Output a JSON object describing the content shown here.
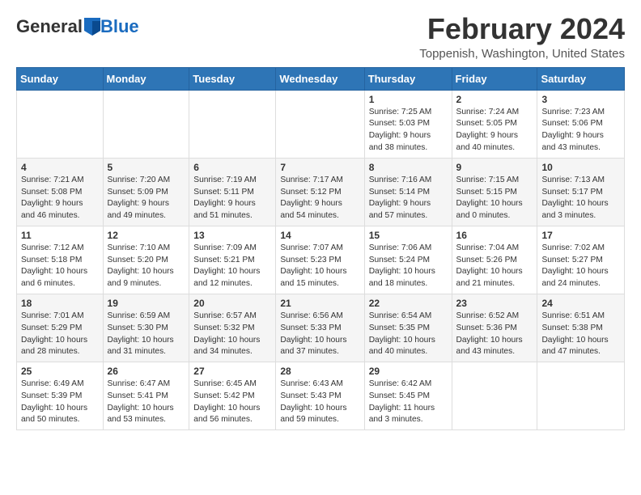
{
  "header": {
    "logo": {
      "part1": "General",
      "part2": "Blue"
    },
    "title": "February 2024",
    "location": "Toppenish, Washington, United States"
  },
  "days_of_week": [
    "Sunday",
    "Monday",
    "Tuesday",
    "Wednesday",
    "Thursday",
    "Friday",
    "Saturday"
  ],
  "weeks": [
    [
      {
        "day": "",
        "info": ""
      },
      {
        "day": "",
        "info": ""
      },
      {
        "day": "",
        "info": ""
      },
      {
        "day": "",
        "info": ""
      },
      {
        "day": "1",
        "info": "Sunrise: 7:25 AM\nSunset: 5:03 PM\nDaylight: 9 hours\nand 38 minutes."
      },
      {
        "day": "2",
        "info": "Sunrise: 7:24 AM\nSunset: 5:05 PM\nDaylight: 9 hours\nand 40 minutes."
      },
      {
        "day": "3",
        "info": "Sunrise: 7:23 AM\nSunset: 5:06 PM\nDaylight: 9 hours\nand 43 minutes."
      }
    ],
    [
      {
        "day": "4",
        "info": "Sunrise: 7:21 AM\nSunset: 5:08 PM\nDaylight: 9 hours\nand 46 minutes."
      },
      {
        "day": "5",
        "info": "Sunrise: 7:20 AM\nSunset: 5:09 PM\nDaylight: 9 hours\nand 49 minutes."
      },
      {
        "day": "6",
        "info": "Sunrise: 7:19 AM\nSunset: 5:11 PM\nDaylight: 9 hours\nand 51 minutes."
      },
      {
        "day": "7",
        "info": "Sunrise: 7:17 AM\nSunset: 5:12 PM\nDaylight: 9 hours\nand 54 minutes."
      },
      {
        "day": "8",
        "info": "Sunrise: 7:16 AM\nSunset: 5:14 PM\nDaylight: 9 hours\nand 57 minutes."
      },
      {
        "day": "9",
        "info": "Sunrise: 7:15 AM\nSunset: 5:15 PM\nDaylight: 10 hours\nand 0 minutes."
      },
      {
        "day": "10",
        "info": "Sunrise: 7:13 AM\nSunset: 5:17 PM\nDaylight: 10 hours\nand 3 minutes."
      }
    ],
    [
      {
        "day": "11",
        "info": "Sunrise: 7:12 AM\nSunset: 5:18 PM\nDaylight: 10 hours\nand 6 minutes."
      },
      {
        "day": "12",
        "info": "Sunrise: 7:10 AM\nSunset: 5:20 PM\nDaylight: 10 hours\nand 9 minutes."
      },
      {
        "day": "13",
        "info": "Sunrise: 7:09 AM\nSunset: 5:21 PM\nDaylight: 10 hours\nand 12 minutes."
      },
      {
        "day": "14",
        "info": "Sunrise: 7:07 AM\nSunset: 5:23 PM\nDaylight: 10 hours\nand 15 minutes."
      },
      {
        "day": "15",
        "info": "Sunrise: 7:06 AM\nSunset: 5:24 PM\nDaylight: 10 hours\nand 18 minutes."
      },
      {
        "day": "16",
        "info": "Sunrise: 7:04 AM\nSunset: 5:26 PM\nDaylight: 10 hours\nand 21 minutes."
      },
      {
        "day": "17",
        "info": "Sunrise: 7:02 AM\nSunset: 5:27 PM\nDaylight: 10 hours\nand 24 minutes."
      }
    ],
    [
      {
        "day": "18",
        "info": "Sunrise: 7:01 AM\nSunset: 5:29 PM\nDaylight: 10 hours\nand 28 minutes."
      },
      {
        "day": "19",
        "info": "Sunrise: 6:59 AM\nSunset: 5:30 PM\nDaylight: 10 hours\nand 31 minutes."
      },
      {
        "day": "20",
        "info": "Sunrise: 6:57 AM\nSunset: 5:32 PM\nDaylight: 10 hours\nand 34 minutes."
      },
      {
        "day": "21",
        "info": "Sunrise: 6:56 AM\nSunset: 5:33 PM\nDaylight: 10 hours\nand 37 minutes."
      },
      {
        "day": "22",
        "info": "Sunrise: 6:54 AM\nSunset: 5:35 PM\nDaylight: 10 hours\nand 40 minutes."
      },
      {
        "day": "23",
        "info": "Sunrise: 6:52 AM\nSunset: 5:36 PM\nDaylight: 10 hours\nand 43 minutes."
      },
      {
        "day": "24",
        "info": "Sunrise: 6:51 AM\nSunset: 5:38 PM\nDaylight: 10 hours\nand 47 minutes."
      }
    ],
    [
      {
        "day": "25",
        "info": "Sunrise: 6:49 AM\nSunset: 5:39 PM\nDaylight: 10 hours\nand 50 minutes."
      },
      {
        "day": "26",
        "info": "Sunrise: 6:47 AM\nSunset: 5:41 PM\nDaylight: 10 hours\nand 53 minutes."
      },
      {
        "day": "27",
        "info": "Sunrise: 6:45 AM\nSunset: 5:42 PM\nDaylight: 10 hours\nand 56 minutes."
      },
      {
        "day": "28",
        "info": "Sunrise: 6:43 AM\nSunset: 5:43 PM\nDaylight: 10 hours\nand 59 minutes."
      },
      {
        "day": "29",
        "info": "Sunrise: 6:42 AM\nSunset: 5:45 PM\nDaylight: 11 hours\nand 3 minutes."
      },
      {
        "day": "",
        "info": ""
      },
      {
        "day": "",
        "info": ""
      }
    ]
  ]
}
